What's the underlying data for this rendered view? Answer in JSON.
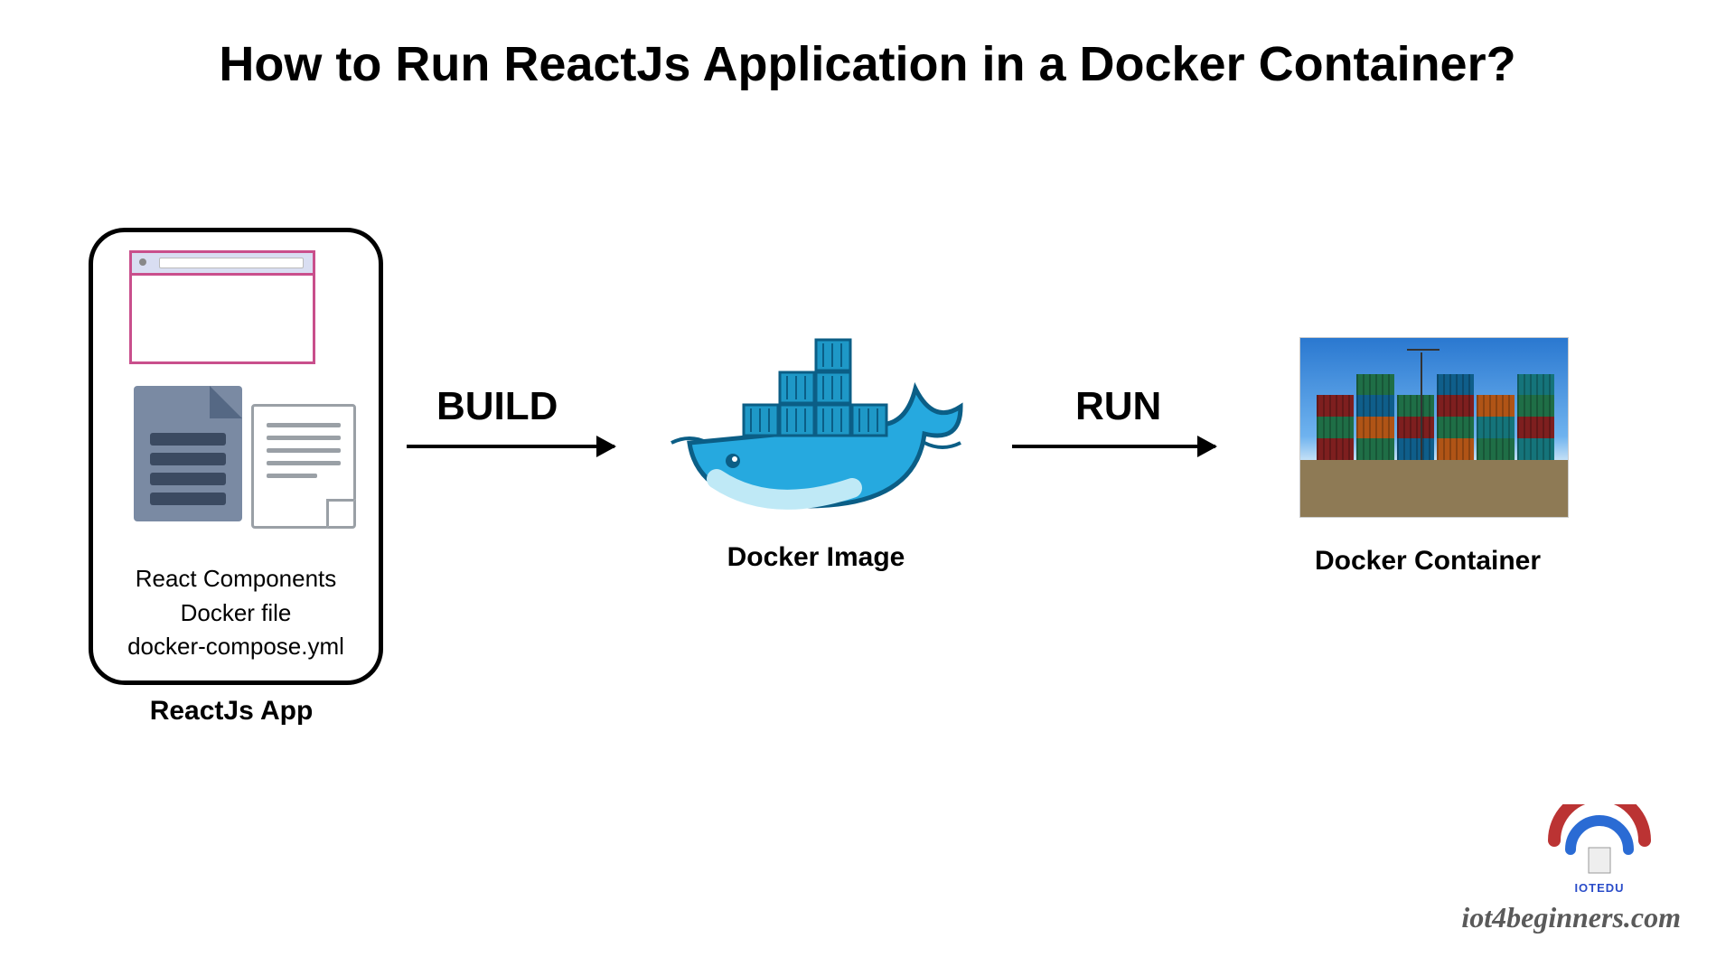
{
  "title": "How to Run ReactJs Application in a Docker Container?",
  "nodes": {
    "react": {
      "caption": "ReactJs App",
      "lines": [
        "React Components",
        "Docker file",
        "docker-compose.yml"
      ]
    },
    "image": {
      "caption": "Docker Image"
    },
    "container": {
      "caption": "Docker Container"
    }
  },
  "arrows": {
    "build": "BUILD",
    "run": "RUN"
  },
  "footer": {
    "logo_text": "IOTEDU",
    "site": "iot4beginners.com"
  },
  "icons": {
    "browser": "browser-window-icon",
    "file_dark": "document-filled-icon",
    "file_light": "document-outline-icon",
    "docker": "docker-whale-icon",
    "containers_photo": "shipping-containers-photo",
    "wifi": "wifi-logo-icon"
  }
}
